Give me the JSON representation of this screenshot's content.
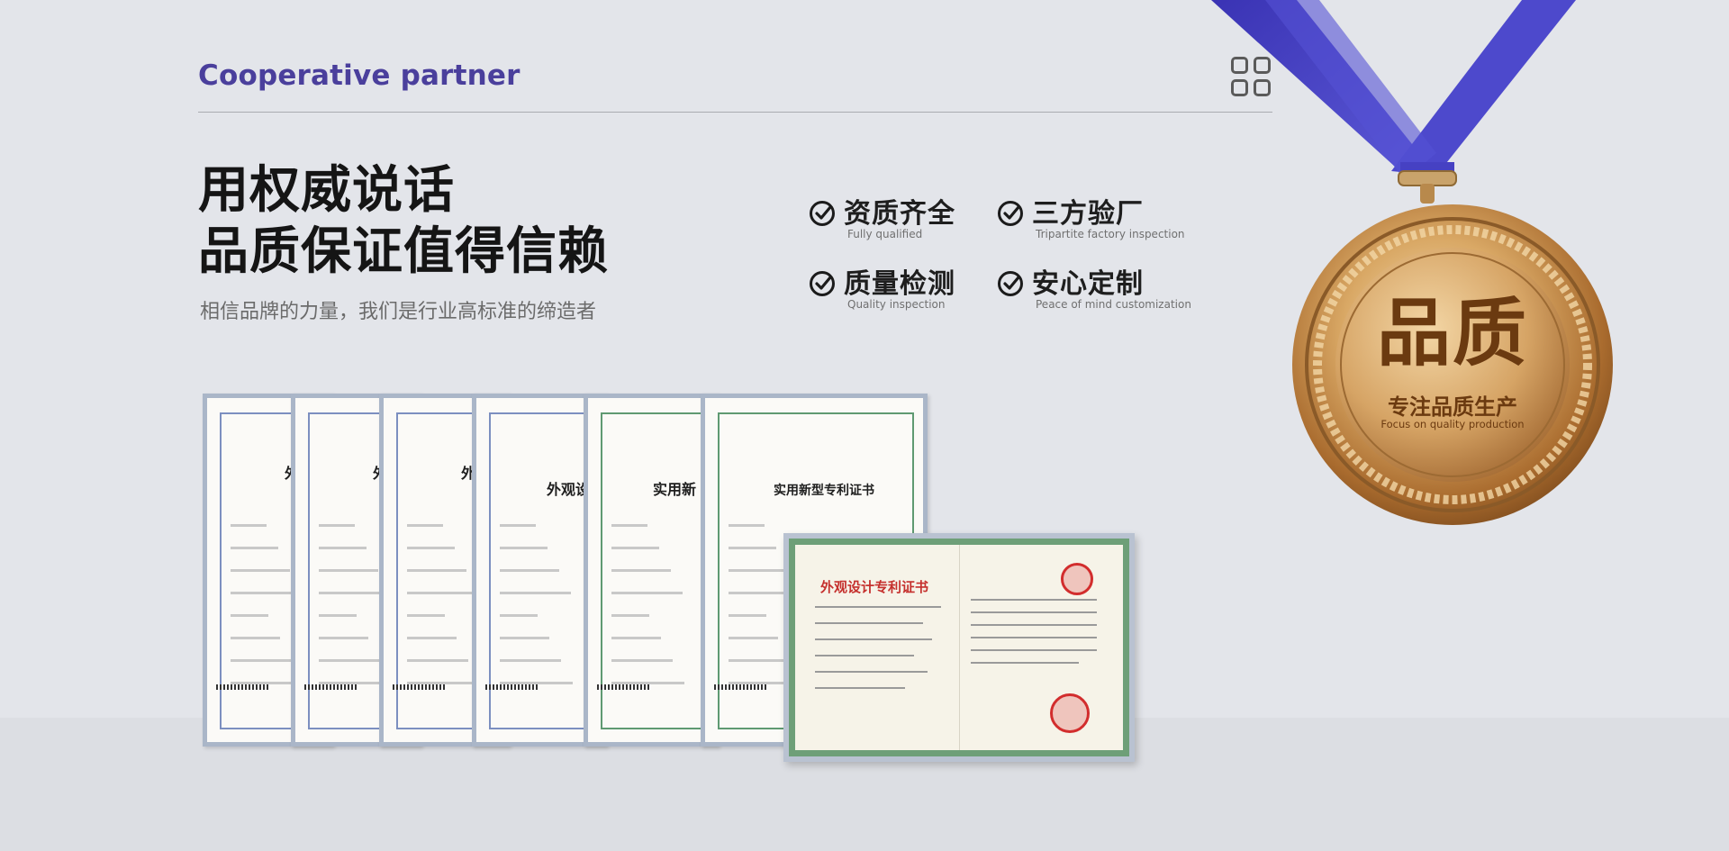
{
  "header": {
    "title": "Cooperative partner",
    "menu_icon": "grid-icon"
  },
  "hero": {
    "headline_line1": "用权威说话",
    "headline_line2": "品质保证值得信赖",
    "subline": "相信品牌的力量，我们是行业高标准的缔造者"
  },
  "features": [
    {
      "title": "资质齐全",
      "subtitle": "Fully qualified",
      "icon": "check-circle-icon"
    },
    {
      "title": "三方验厂",
      "subtitle": "Tripartite factory inspection",
      "icon": "check-circle-icon"
    },
    {
      "title": "质量检测",
      "subtitle": "Quality inspection",
      "icon": "check-circle-icon"
    },
    {
      "title": "安心定制",
      "subtitle": "Peace of mind customization",
      "icon": "check-circle-icon"
    }
  ],
  "certificates": {
    "back_titles": [
      "外",
      "外",
      "外",
      "外观设",
      "实用新",
      "实用新型专利证书"
    ],
    "front_title": "外观设计专利证书"
  },
  "medal": {
    "main_text": "品质",
    "sub_text": "专注品质生产",
    "sub_text_en": "Focus on quality production",
    "ribbon_color": "#4a45c9",
    "gold_color": "#c8924a"
  }
}
